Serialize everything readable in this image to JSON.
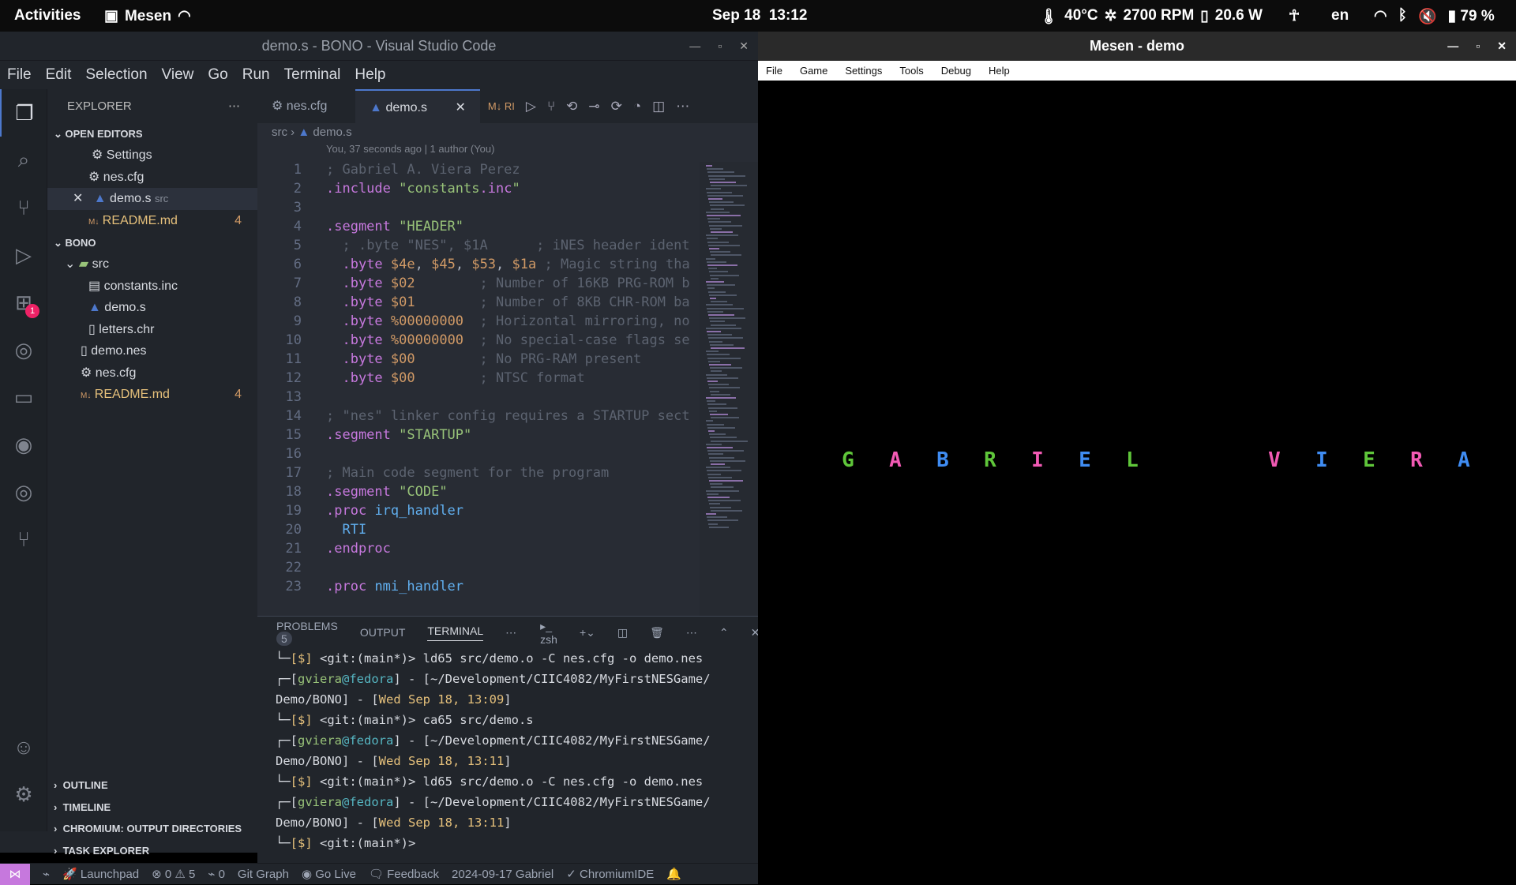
{
  "topbar": {
    "activities": "Activities",
    "app": "Mesen",
    "date": "Sep 18",
    "time": "13:12",
    "temp": "40°C",
    "fan": "2700 RPM",
    "power": "20.6 W",
    "lang": "en",
    "battery": "79 %"
  },
  "vscode": {
    "title": "demo.s - BONO - Visual Studio Code",
    "menu": [
      "File",
      "Edit",
      "Selection",
      "View",
      "Go",
      "Run",
      "Terminal",
      "Help"
    ],
    "explorer": {
      "header": "EXPLORER",
      "open_editors": "OPEN EDITORS",
      "open_items": [
        {
          "name": "Settings",
          "extra": "",
          "count": ""
        },
        {
          "name": "nes.cfg",
          "extra": "",
          "count": ""
        },
        {
          "name": "demo.s",
          "extra": "src",
          "count": ""
        },
        {
          "name": "README.md",
          "extra": "",
          "count": "4"
        }
      ],
      "workspace": "BONO",
      "tree": [
        {
          "name": "src",
          "count": ""
        },
        {
          "name": "constants.inc",
          "count": ""
        },
        {
          "name": "demo.s",
          "count": ""
        },
        {
          "name": "letters.chr",
          "count": ""
        },
        {
          "name": "demo.nes",
          "count": ""
        },
        {
          "name": "nes.cfg",
          "count": ""
        },
        {
          "name": "README.md",
          "count": "4"
        }
      ],
      "sections": [
        "OUTLINE",
        "TIMELINE",
        "CHROMIUM: OUTPUT DIRECTORIES",
        "TASK EXPLORER"
      ]
    },
    "tabs": [
      "nes.cfg",
      "demo.s"
    ],
    "tab_extra": "RI",
    "breadcrumb": [
      "src",
      "demo.s"
    ],
    "blame": "You, 37 seconds ago | 1 author (You)",
    "lines": [
      "; Gabriel A. Viera Perez",
      ".include \"constants.inc\"",
      "",
      ".segment \"HEADER\"",
      "  ; .byte \"NES\", $1A      ; iNES header ident",
      "  .byte $4e, $45, $53, $1a ; Magic string tha",
      "  .byte $02        ; Number of 16KB PRG-ROM b",
      "  .byte $01        ; Number of 8KB CHR-ROM ba",
      "  .byte %00000000  ; Horizontal mirroring, no",
      "  .byte %00000000  ; No special-case flags se",
      "  .byte $00        ; No PRG-RAM present",
      "  .byte $00        ; NTSC format",
      "",
      "; \"nes\" linker config requires a STARTUP sect",
      ".segment \"STARTUP\"",
      "",
      "; Main code segment for the program",
      ".segment \"CODE\"",
      ".proc irq_handler",
      "  RTI",
      ".endproc",
      "",
      ".proc nmi_handler"
    ],
    "panel_tabs": [
      "PROBLEMS",
      "OUTPUT",
      "TERMINAL"
    ],
    "problems_count": "5",
    "shell": "zsh",
    "terminal": [
      "└─[$] <git:(main*)> ld65 src/demo.o -C nes.cfg -o demo.nes",
      "┌─[gviera@fedora] - [~/Development/CIIC4082/MyFirstNESGame/",
      "Demo/BONO] - [Wed Sep 18, 13:09]",
      "└─[$] <git:(main*)> ca65 src/demo.s",
      "┌─[gviera@fedora] - [~/Development/CIIC4082/MyFirstNESGame/",
      "Demo/BONO] - [Wed Sep 18, 13:11]",
      "└─[$] <git:(main*)> ld65 src/demo.o -C nes.cfg -o demo.nes",
      "┌─[gviera@fedora] - [~/Development/CIIC4082/MyFirstNESGame/",
      "Demo/BONO] - [Wed Sep 18, 13:11]",
      "└─[$] <git:(main*)> "
    ],
    "status": {
      "launchpad": "Launchpad",
      "errors": "0",
      "warnings": "5",
      "ports": "0",
      "git_graph": "Git Graph",
      "golive": "Go Live",
      "feedback": "Feedback",
      "blame": "2024-09-17  Gabriel",
      "chromium": "ChromiumIDE"
    }
  },
  "mesen": {
    "title": "Mesen - demo",
    "menu": [
      "File",
      "Game",
      "Settings",
      "Tools",
      "Debug",
      "Help"
    ],
    "letters": [
      {
        "ch": "G",
        "color": "#5fc63a"
      },
      {
        "ch": "A",
        "color": "#f25ab4"
      },
      {
        "ch": "B",
        "color": "#3f8cf2"
      },
      {
        "ch": "R",
        "color": "#5fc63a"
      },
      {
        "ch": "I",
        "color": "#f25ab4"
      },
      {
        "ch": "E",
        "color": "#3f8cf2"
      },
      {
        "ch": "L",
        "color": "#5fc63a"
      },
      {
        "ch": "V",
        "color": "#f25ab4"
      },
      {
        "ch": "I",
        "color": "#3f8cf2"
      },
      {
        "ch": "E",
        "color": "#5fc63a"
      },
      {
        "ch": "R",
        "color": "#f25ab4"
      },
      {
        "ch": "A",
        "color": "#3f8cf2"
      }
    ]
  }
}
